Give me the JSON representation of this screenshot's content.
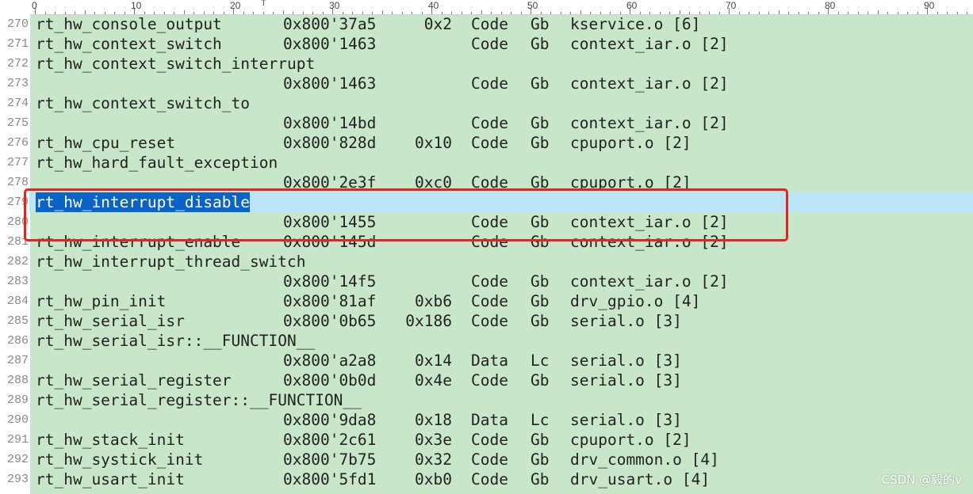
{
  "ruler": {
    "labels": [
      "0",
      "10",
      "20",
      "30",
      "40",
      "50",
      "60",
      "70",
      "80",
      "90"
    ],
    "caret": "T"
  },
  "lines": [
    {
      "ln": "270",
      "name": "rt_hw_console_output",
      "addr": "0x800'37a5",
      "size": "0x2",
      "kind": "Code",
      "scope": "Gb",
      "obj": "kservice.o [6]"
    },
    {
      "ln": "271",
      "name": "rt_hw_context_switch",
      "addr": "0x800'1463",
      "size": "",
      "kind": "Code",
      "scope": "Gb",
      "obj": "context_iar.o [2]"
    },
    {
      "ln": "272",
      "name": "rt_hw_context_switch_interrupt",
      "addr": "",
      "size": "",
      "kind": "",
      "scope": "",
      "obj": ""
    },
    {
      "ln": "273",
      "name": "",
      "addr": "0x800'1463",
      "size": "",
      "kind": "Code",
      "scope": "Gb",
      "obj": "context_iar.o [2]"
    },
    {
      "ln": "274",
      "name": "rt_hw_context_switch_to",
      "addr": "",
      "size": "",
      "kind": "",
      "scope": "",
      "obj": ""
    },
    {
      "ln": "275",
      "name": "",
      "addr": "0x800'14bd",
      "size": "",
      "kind": "Code",
      "scope": "Gb",
      "obj": "context_iar.o [2]"
    },
    {
      "ln": "276",
      "name": "rt_hw_cpu_reset",
      "addr": "0x800'828d",
      "size": "0x10",
      "kind": "Code",
      "scope": "Gb",
      "obj": "cpuport.o [2]"
    },
    {
      "ln": "277",
      "name": "rt_hw_hard_fault_exception",
      "addr": "",
      "size": "",
      "kind": "",
      "scope": "",
      "obj": ""
    },
    {
      "ln": "278",
      "name": "",
      "addr": "0x800'2e3f",
      "size": "0xc0",
      "kind": "Code",
      "scope": "Gb",
      "obj": "cpuport.o [2]"
    },
    {
      "ln": "279",
      "name": "rt_hw_interrupt_disable",
      "addr": "",
      "size": "",
      "kind": "",
      "scope": "",
      "obj": "",
      "current": true,
      "selected": true
    },
    {
      "ln": "280",
      "name": "",
      "addr": "0x800'1455",
      "size": "",
      "kind": "Code",
      "scope": "Gb",
      "obj": "context_iar.o [2]"
    },
    {
      "ln": "281",
      "name": "rt_hw_interrupt_enable",
      "addr": "0x800'145d",
      "size": "",
      "kind": "Code",
      "scope": "Gb",
      "obj": "context_iar.o [2]"
    },
    {
      "ln": "282",
      "name": "rt_hw_interrupt_thread_switch",
      "addr": "",
      "size": "",
      "kind": "",
      "scope": "",
      "obj": ""
    },
    {
      "ln": "283",
      "name": "",
      "addr": "0x800'14f5",
      "size": "",
      "kind": "Code",
      "scope": "Gb",
      "obj": "context_iar.o [2]"
    },
    {
      "ln": "284",
      "name": "rt_hw_pin_init",
      "addr": "0x800'81af",
      "size": "0xb6",
      "kind": "Code",
      "scope": "Gb",
      "obj": "drv_gpio.o [4]"
    },
    {
      "ln": "285",
      "name": "rt_hw_serial_isr",
      "addr": "0x800'0b65",
      "size": "0x186",
      "kind": "Code",
      "scope": "Gb",
      "obj": "serial.o [3]"
    },
    {
      "ln": "286",
      "name": "rt_hw_serial_isr::__FUNCTION__",
      "addr": "",
      "size": "",
      "kind": "",
      "scope": "",
      "obj": ""
    },
    {
      "ln": "287",
      "name": "",
      "addr": "0x800'a2a8",
      "size": "0x14",
      "kind": "Data",
      "scope": "Lc",
      "obj": "serial.o [3]"
    },
    {
      "ln": "288",
      "name": "rt_hw_serial_register",
      "addr": "0x800'0b0d",
      "size": "0x4e",
      "kind": "Code",
      "scope": "Gb",
      "obj": "serial.o [3]"
    },
    {
      "ln": "289",
      "name": "rt_hw_serial_register::__FUNCTION__",
      "addr": "",
      "size": "",
      "kind": "",
      "scope": "",
      "obj": ""
    },
    {
      "ln": "290",
      "name": "",
      "addr": "0x800'9da8",
      "size": "0x18",
      "kind": "Data",
      "scope": "Lc",
      "obj": "serial.o [3]"
    },
    {
      "ln": "291",
      "name": "rt_hw_stack_init",
      "addr": "0x800'2c61",
      "size": "0x3e",
      "kind": "Code",
      "scope": "Gb",
      "obj": "cpuport.o [2]"
    },
    {
      "ln": "292",
      "name": "rt_hw_systick_init",
      "addr": "0x800'7b75",
      "size": "0x32",
      "kind": "Code",
      "scope": "Gb",
      "obj": "drv_common.o [4]"
    },
    {
      "ln": "293",
      "name": "rt_hw_usart_init",
      "addr": "0x800'5fd1",
      "size": "0xb0",
      "kind": "Code",
      "scope": "Gb",
      "obj": "drv_usart.o [4]"
    }
  ],
  "watermark": "CSDN @毅的v",
  "colors": {
    "background": "#c8e6c9",
    "current_line": "#bde5f8",
    "selection": "#0a64c8",
    "highlight_box": "#e0261e"
  }
}
